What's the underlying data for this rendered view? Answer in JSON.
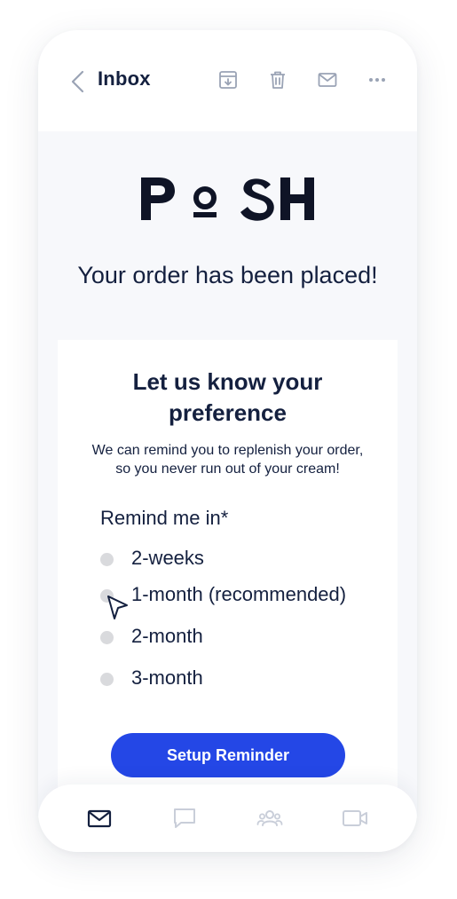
{
  "header": {
    "back_icon": "chevron-left-icon",
    "title": "Inbox",
    "actions": [
      {
        "name": "archive",
        "icon": "archive-download-icon"
      },
      {
        "name": "delete",
        "icon": "trash-icon"
      },
      {
        "name": "mark-unread",
        "icon": "envelope-icon"
      },
      {
        "name": "more",
        "icon": "more-horizontal-icon"
      }
    ]
  },
  "email": {
    "brand_logo_text": "POSH",
    "headline": "Your order has been placed!",
    "card": {
      "title": "Let us know your preference",
      "description_line1": "We can remind you to replenish your order,",
      "description_line2": "so you never run out of your cream!",
      "remind_label": "Remind me in*",
      "options": [
        {
          "label": "2-weeks",
          "selected": false
        },
        {
          "label": "1-month (recommended)",
          "selected": false
        },
        {
          "label": "2-month",
          "selected": false
        },
        {
          "label": "3-month",
          "selected": false
        }
      ],
      "cta_label": "Setup Reminder"
    }
  },
  "tabbar": {
    "tabs": [
      {
        "name": "mail",
        "icon": "mail-icon",
        "active": true
      },
      {
        "name": "chat",
        "icon": "chat-bubble-icon",
        "active": false
      },
      {
        "name": "contacts",
        "icon": "people-icon",
        "active": false
      },
      {
        "name": "video",
        "icon": "video-camera-icon",
        "active": false
      }
    ]
  },
  "colors": {
    "text": "#14203f",
    "accent": "#2447e6",
    "radio": "#d9dadd",
    "icon_muted": "#9aa3b5",
    "icon_inactive": "#c9ced9",
    "background": "#f7f8fb"
  }
}
